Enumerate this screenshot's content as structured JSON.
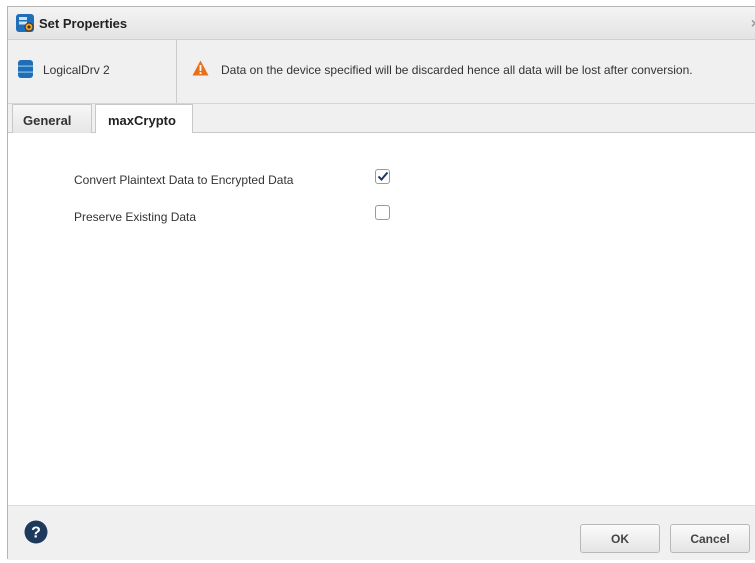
{
  "window": {
    "title": "Set Properties",
    "close_glyph": "×",
    "icon": "storage-settings-icon"
  },
  "device": {
    "name": "LogicalDrv 2",
    "icon": "database-icon"
  },
  "warning": {
    "text": "Data on the device specified will be discarded hence all data will be lost after conversion.",
    "icon": "warning-icon",
    "color": "#e8701a"
  },
  "tabs": [
    {
      "label": "General",
      "active": false
    },
    {
      "label": "maxCrypto",
      "active": true
    }
  ],
  "options": [
    {
      "label": "Convert Plaintext Data to Encrypted Data",
      "checked": true
    },
    {
      "label": "Preserve Existing Data",
      "checked": false
    }
  ],
  "footer": {
    "help_icon": "help-icon",
    "ok_label": "OK",
    "cancel_label": "Cancel"
  },
  "colors": {
    "accent": "#1e6fb8",
    "help": "#1d3a5c"
  }
}
